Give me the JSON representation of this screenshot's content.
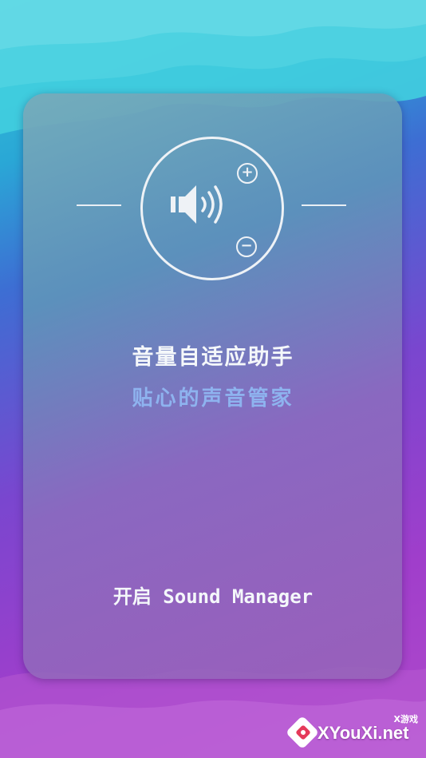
{
  "colors": {
    "accent_subtitle": "#8eb3ef",
    "text_light": "#f4f7fa",
    "background_top": "#35c7d8",
    "background_bottom": "#b04acb"
  },
  "icons": {
    "speaker": "volume-speaker-icon",
    "plus": "plus-icon",
    "minus": "minus-icon",
    "logo": "gamepad-logo-icon"
  },
  "hero": {
    "plus_symbol": "+",
    "minus_symbol": "−"
  },
  "main": {
    "title": "音量自适应助手",
    "subtitle": "贴心的声音管家",
    "start_button_label": "开启 Sound Manager"
  },
  "watermark": {
    "small_text": "X游戏",
    "site_text": "XYouXi.net"
  }
}
